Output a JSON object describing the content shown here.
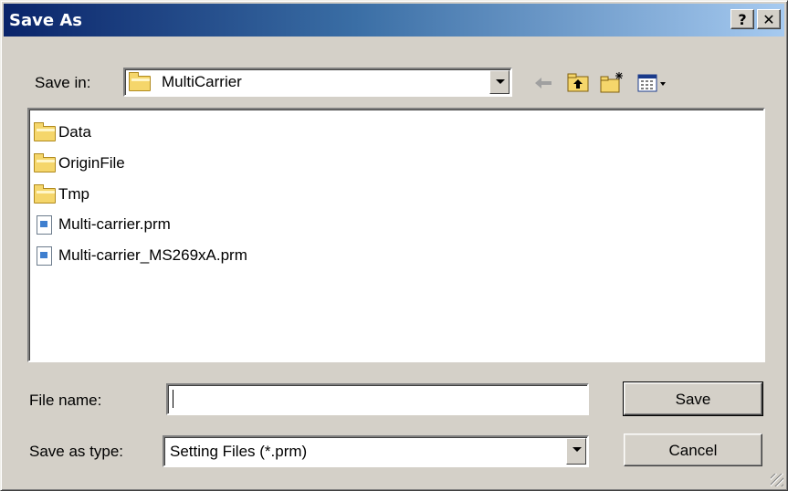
{
  "window": {
    "title": "Save As",
    "help_label": "?",
    "close_label": "✕"
  },
  "save_in": {
    "label": "Save in:",
    "value": "MultiCarrier",
    "value_icon": "folder-icon"
  },
  "toolbar": {
    "icons": [
      "back-arrow-icon",
      "up-folder-icon",
      "new-folder-icon",
      "view-menu-icon"
    ]
  },
  "files": [
    {
      "name": "Data",
      "icon": "folder-icon"
    },
    {
      "name": "OriginFile",
      "icon": "folder-icon"
    },
    {
      "name": "Tmp",
      "icon": "folder-icon"
    },
    {
      "name": "Multi-carrier.prm",
      "icon": "document-icon"
    },
    {
      "name": "Multi-carrier_MS269xA.prm",
      "icon": "document-icon"
    }
  ],
  "file_name": {
    "label": "File name:",
    "value": ""
  },
  "save_as_type": {
    "label": "Save as type:",
    "value": "Setting Files (*.prm)"
  },
  "buttons": {
    "save": "Save",
    "cancel": "Cancel"
  }
}
